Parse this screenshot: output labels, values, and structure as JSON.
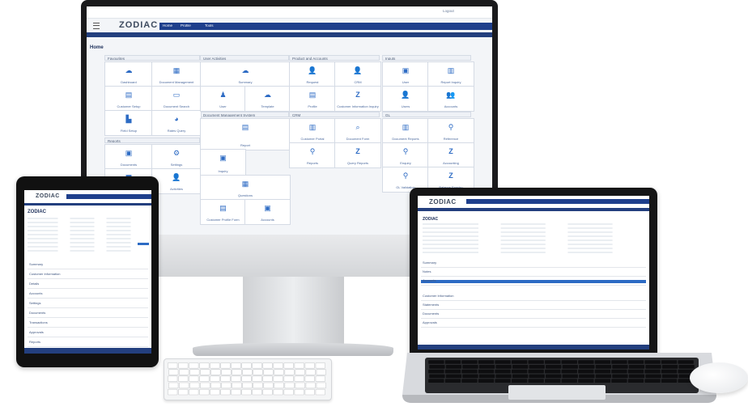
{
  "brand": {
    "name": "ZODIAC",
    "accent": "#1e3f8c",
    "tile_icon_color": "#2d6bc4"
  },
  "monitor": {
    "tabs": [
      "Home",
      "Profile",
      "Tools"
    ],
    "user": "Logout",
    "home_title": "Home",
    "sections": [
      "Favourites",
      "User Activities",
      "Product and Accounts",
      "Inputs",
      "Reports",
      "Document Management System",
      "CRM",
      "GL"
    ],
    "tiles": [
      "Dashboard",
      "Document Management",
      "Customer Setup",
      "Document Search",
      "Field Setup",
      "Rates Query",
      "Documents",
      "Settings",
      "Inbox",
      "Activities",
      "Summary",
      "User",
      "Template",
      "Report",
      "Inquiry",
      "Questions",
      "Customer Profile Form",
      "Accounts",
      "Request",
      "CRM",
      "Profile",
      "Customer Information Inquiry",
      "Customer Portal",
      "Document Form",
      "Reports",
      "Query Reports",
      "User",
      "Report Inquiry",
      "Users",
      "Accounts",
      "Document Reports",
      "Reference",
      "Enquiry",
      "Accounting",
      "GL Validation",
      "Balance Enquiry"
    ]
  },
  "tablet": {
    "account": "ZODIAC",
    "panel_rows": [
      "Summary",
      "Customer Information",
      "Details",
      "Accounts",
      "Settings",
      "Documents",
      "Transactions",
      "Approvals",
      "Reports"
    ]
  },
  "laptop": {
    "account": "ZODIAC",
    "panel_rows": [
      "Summary",
      "Notes",
      "Accounts",
      "Customer Information",
      "Statements",
      "Documents",
      "Approvals"
    ]
  }
}
